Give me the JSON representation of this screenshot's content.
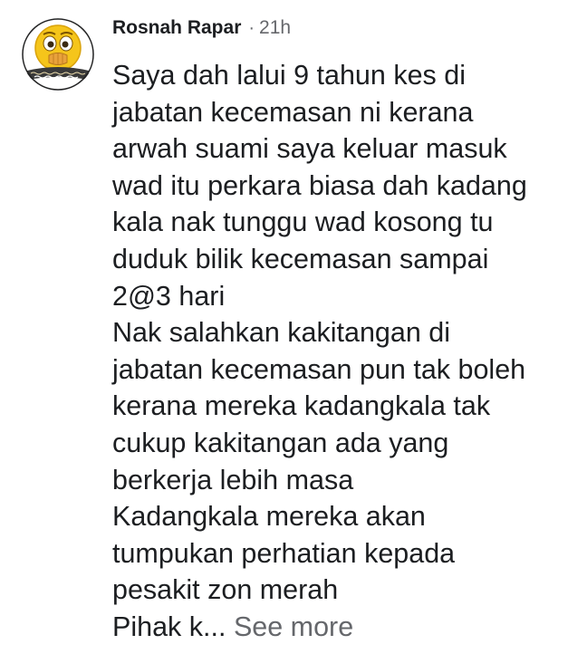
{
  "comment": {
    "author": "Rosnah Rapar",
    "separator": "·",
    "timestamp": "21h",
    "avatar": {
      "icon": "face-with-hand-over-mouth-emoji",
      "badge_text": "Suporters Apa Yang Ada Fi Jin BAHAGIA",
      "colors": {
        "face": "#f5c51b",
        "face_edge": "#d9a20a",
        "ring": "#222222",
        "badge": "#3a3a3a"
      }
    },
    "text_lines": [
      "Saya dah lalui 9 tahun kes di",
      "jabatan kecemasan ni kerana",
      "arwah suami saya keluar masuk",
      "wad itu perkara biasa dah kadang",
      "kala nak tunggu wad kosong tu",
      "duduk bilik kecemasan sampai",
      "2@3 hari",
      "Nak salahkan kakitangan di",
      "jabatan kecemasan pun tak boleh",
      "kerana mereka kadangkala tak",
      "cukup kakitangan ada yang",
      "berkerja lebih masa",
      "Kadangkala mereka akan",
      "tumpukan perhatian kepada",
      "pesakit zon merah"
    ],
    "truncated_line": "Pihak k...",
    "see_more_label": "See more"
  }
}
